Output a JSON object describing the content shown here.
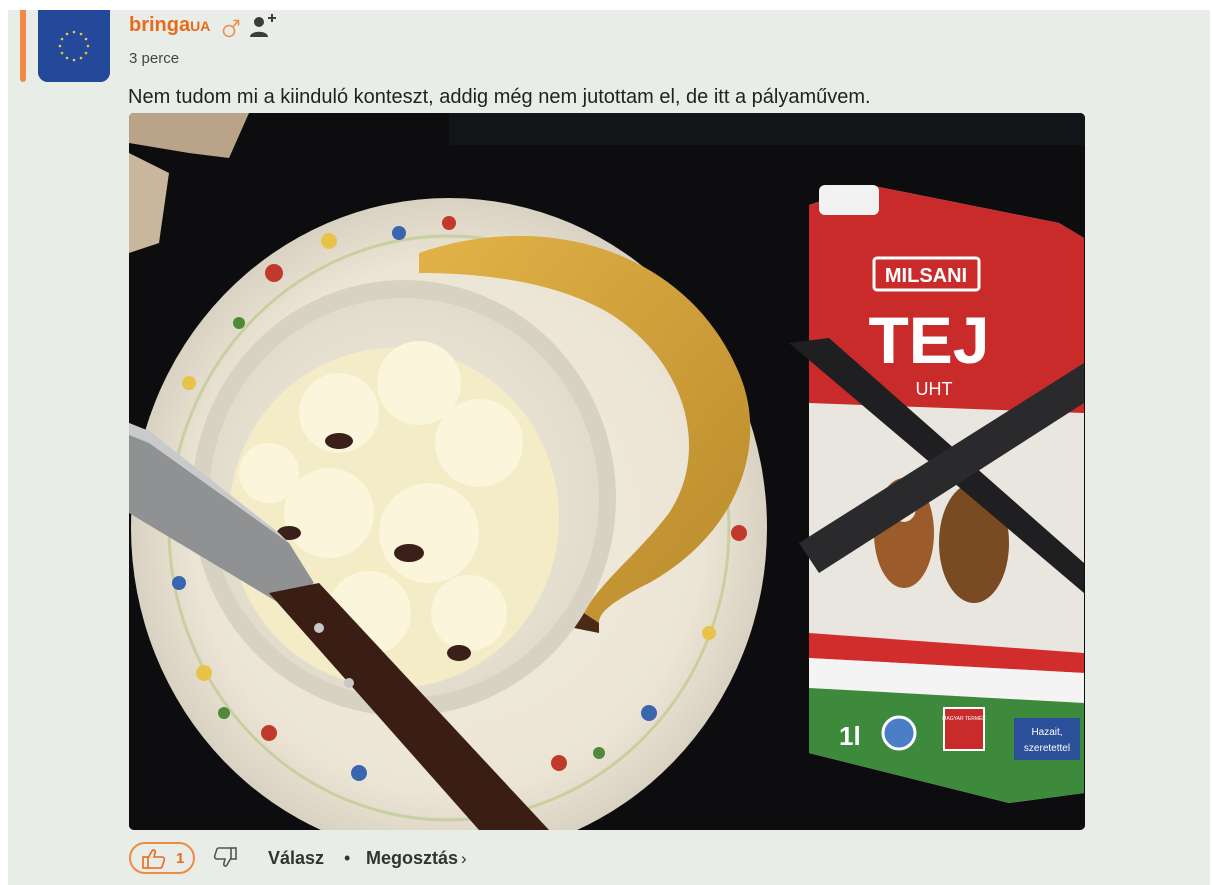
{
  "comment": {
    "username": "bringa",
    "username_suffix": "UA",
    "gender_icon": "male-symbol-icon",
    "follow_icon": "add-friend-icon",
    "time": "3 perce",
    "text": "Nem tudom mi a kiinduló konteszt, addig még nem jutottam el, de itt a pályaművem.",
    "accent_color": "#e86a1b",
    "background_color": "#e9ede7"
  },
  "photo": {
    "brand": "MILSANI",
    "product": "TEJ",
    "type": "UHT",
    "volume": "1l",
    "badge_line1": "Hazait,",
    "badge_line2": "szeretettel",
    "seal_text": "MAGYAR TERMÉK"
  },
  "actions": {
    "like_icon": "thumbs-up-icon",
    "like_count": "1",
    "dislike_icon": "thumbs-down-icon",
    "reply_label": "Válasz",
    "separator": "•",
    "share_label": "Megosztás",
    "share_chevron": "›"
  }
}
